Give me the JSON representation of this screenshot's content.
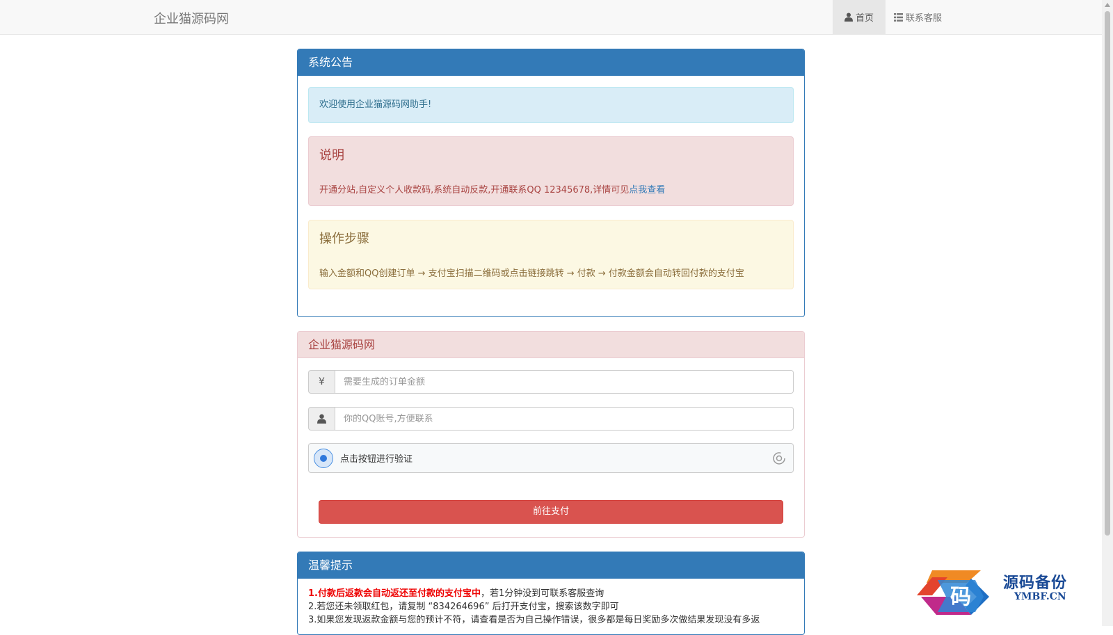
{
  "navbar": {
    "brand": "企业猫源码网",
    "home_label": "首页",
    "service_label": "联系客服"
  },
  "notice_panel": {
    "title": "系统公告",
    "welcome": "欢迎使用企业猫源码网助手!",
    "desc_title": "说明",
    "desc_text": "开通分站,自定义个人收款码,系统自动反款,开通联系QQ 12345678,详情可见",
    "desc_link": "点我查看",
    "steps_title": "操作步骤",
    "steps_text": "输入金额和QQ创建订单 → 支付宝扫描二维码或点击链接跳转 → 付款 → 付款金额会自动转回付款的支付宝"
  },
  "order_panel": {
    "title": "企业猫源码网",
    "amount_addon": "¥",
    "amount_placeholder": "需要生成的订单金额",
    "qq_placeholder": "你的QQ账号,方便联系",
    "captcha_label": "点击按钮进行验证",
    "submit_label": "前往支付"
  },
  "tips_panel": {
    "title": "温馨提示",
    "tip1_red": "1.付款后返款会自动返还至付款的支付宝中",
    "tip1_rest": "，若1分钟没到可联系客服查询",
    "tip2": "2.若您还未领取红包，请复制 “834264696” 后打开支付宝，搜索该数字即可",
    "tip3": "3.如果您发现返款金额与您的预计不符，请查看是否为自己操作错误，很多都是每日奖励多次做结果发现没有多返"
  },
  "watermark": {
    "glyph": "码",
    "cn": "源码备份",
    "en": "YMBF.CN"
  },
  "colors": {
    "primary": "#337ab7",
    "danger": "#d9534f",
    "info_bg": "#d9edf7",
    "danger_bg": "#f2dede",
    "warning_bg": "#fcf8e3"
  }
}
